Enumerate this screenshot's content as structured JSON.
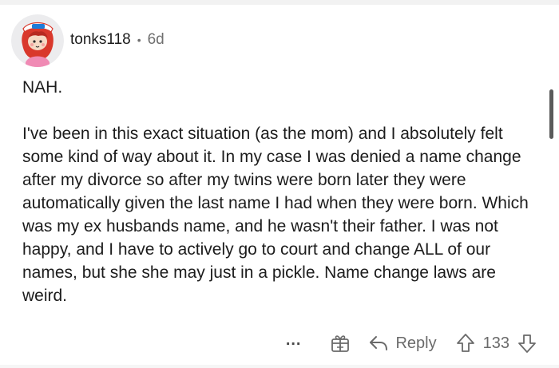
{
  "comment": {
    "author": "tonks118",
    "separator": "•",
    "age": "6d",
    "body": {
      "first_line": "NAH.",
      "paragraph": "I've been in this exact situation (as the mom) and I absolutely felt some kind of way about it. In my case I was denied a name change after my divorce so after my twins were born later they were automatically given the last name I had when they were born. Which was my ex husbands name, and he wasn't their father. I was not happy, and I have to actively go to court and change ALL of our names, but she she may just in a pickle. Name change laws are weird."
    }
  },
  "actions": {
    "more_label": "...",
    "reply_label": "Reply",
    "score": "133"
  },
  "icons": {
    "more": "more-options-icon",
    "gift": "gift-award-icon",
    "reply": "reply-arrow-icon",
    "upvote": "upvote-arrow-icon",
    "downvote": "downvote-arrow-icon"
  },
  "colors": {
    "text": "#1c1c1c",
    "muted": "#707070",
    "avatar_bg": "#e9e9eb",
    "avatar_accent": "#d9382c"
  }
}
